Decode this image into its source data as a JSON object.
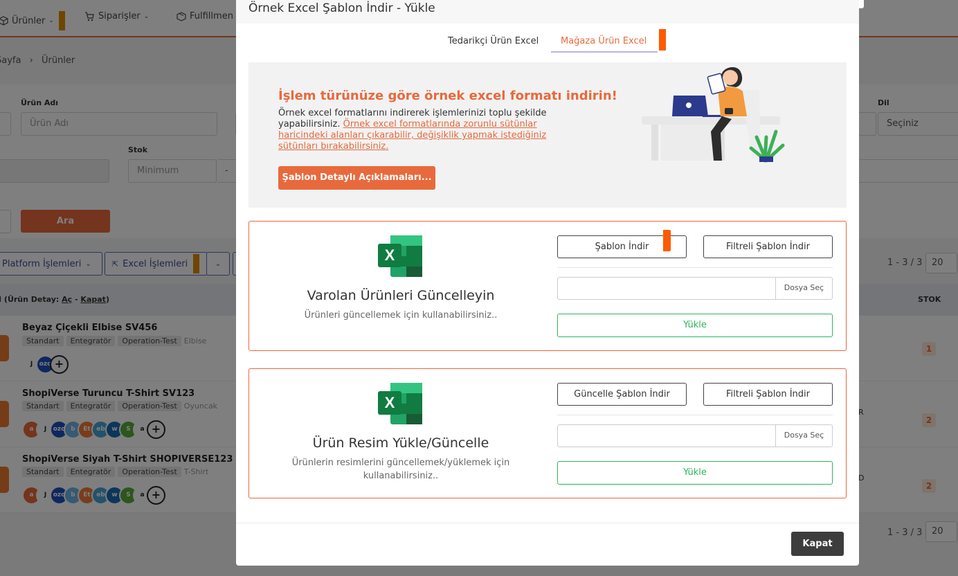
{
  "nav": {
    "items": [
      {
        "label": "Ürünler",
        "icon": "cube-icon"
      },
      {
        "label": "Siparişler",
        "icon": "cart-icon"
      },
      {
        "label": "Fulfillmen",
        "icon": "box-icon"
      }
    ]
  },
  "breadcrumb": {
    "home": "Sayfa",
    "separator": "›",
    "current": "Ürünler"
  },
  "filters": {
    "product_name_label": "Ürün Adı",
    "product_name_placeholder": "Ürün Adı",
    "stock_label": "Stok",
    "stock_min_placeholder": "Minimum",
    "stock_dash": "-",
    "language_label": "Dil",
    "language_value": "Seçiniz",
    "search_button": "Ara"
  },
  "toolbar": {
    "platform_ops": "Platform İşlemleri",
    "excel_ops": "Excel İşlemleri",
    "pager_text": "1 - 3 / 3",
    "page_size": "20"
  },
  "table": {
    "detail_header_prefix": "I (Ürün Detay: ",
    "detail_open": "Aç",
    "detail_sep": " - ",
    "detail_close": "Kapat",
    "detail_suffix": ")",
    "stock_header": "STOK",
    "rows": [
      {
        "name": "Beyaz Çiçekli Elbise SV456",
        "tags": [
          "Standart",
          "Entegratör",
          "Operation-Test"
        ],
        "category": "Elbise",
        "stock": "1",
        "side": ""
      },
      {
        "name": "ShopiVerse Turuncu T-Shirt SV123",
        "tags": [
          "Standart",
          "Entegratör",
          "Operation-Test"
        ],
        "category": "Oyuncak",
        "stock": "2",
        "side": "R"
      },
      {
        "name": "ShopiVerse Siyah T-Shirt SHOPIVERSE123",
        "tags": [
          "Standart",
          "Entegratör",
          "Operation-Test"
        ],
        "category": "T-Shirt",
        "stock": "2",
        "side": "D"
      }
    ]
  },
  "modal": {
    "title": "Örnek Excel Şablon İndir - Yükle",
    "close_icon": "×",
    "tabs": [
      {
        "label": "Tedarikçi Ürün Excel",
        "active": false
      },
      {
        "label": "Mağaza Ürün Excel",
        "active": true
      }
    ],
    "info": {
      "heading": "İşlem türünüze göre örnek excel formatı indirin!",
      "text": "Örnek excel formatlarını indirerek işlemlerinizi toplu şekilde yapabilirsiniz. ",
      "link_text": "Örnek excel formatlarında zorunlu sütünlar haricindeki alanları çıkarabilir, değişiklik yapmak istediğiniz sütünları bırakabilirsiniz.",
      "button": "Şablon Detaylı Açıklamaları..."
    },
    "cards": [
      {
        "title": "Varolan Ürünleri Güncelleyin",
        "subtitle": "Ürünleri güncellemek için kullanabilirsiniz..",
        "btn_left": "Şablon İndir",
        "btn_right": "Filtreli Şablon İndir",
        "file_button": "Dosya Seç",
        "upload": "Yükle"
      },
      {
        "title": "Ürün Resim Yükle/Güncelle",
        "subtitle": "Ürünlerin resimlerini güncellemek/yüklemek için kullanabilirsiniz..",
        "btn_left": "Güncelle Şablon İndir",
        "btn_right": "Filtreli Şablon İndir",
        "file_button": "Dosya Seç",
        "upload": "Yükle"
      }
    ],
    "footer_close": "Kapat"
  },
  "colors": {
    "accent": "#e8693c",
    "success": "#2fb35a",
    "dark_button": "#3d3d3d",
    "excel_green": "#1e7145"
  }
}
